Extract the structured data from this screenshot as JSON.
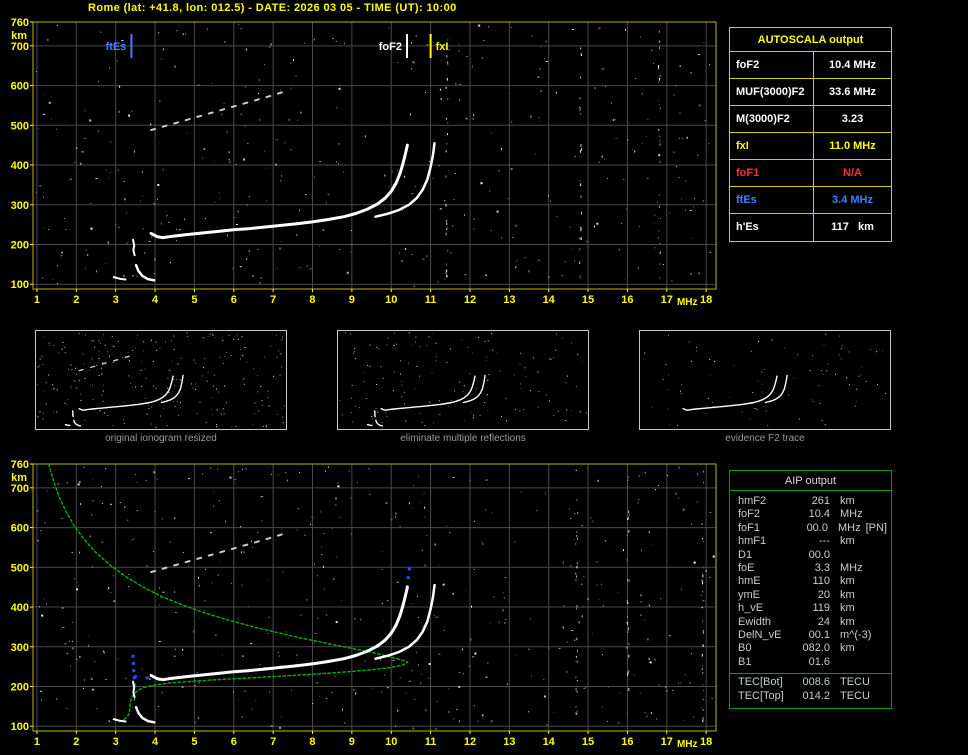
{
  "title": "Rome (lat: +41.8, lon: 012.5) - DATE: 2026 03 05 - TIME (UT): 10:00",
  "colors": {
    "background": "#000000",
    "title": "#ffff00",
    "plot_border": "#b8b800",
    "grid": "#4a4a4a",
    "axis_label": "#ffff00",
    "trace": "#ffffff",
    "profile_green": "#00b400",
    "fit_blue": "#3344ee",
    "ftEs_blue": "#4080ff",
    "fxI_yellow": "#ffff00",
    "na_red": "#ff3333",
    "autoscala_border": "#cfcf00",
    "aip_border": "#00a000"
  },
  "autoscala_table": {
    "title": "AUTOSCALA output",
    "rows": [
      {
        "label": "foF2",
        "value": "10.4 MHz",
        "color": "#ffffff"
      },
      {
        "label": "MUF(3000)F2",
        "value": "33.6 MHz",
        "color": "#ffffff"
      },
      {
        "label": "M(3000)F2",
        "value": "3.23",
        "color": "#ffffff"
      },
      {
        "label": "fxI",
        "value": "11.0 MHz",
        "color": "#ffff00"
      },
      {
        "label": "foF1",
        "value": "N/A",
        "color": "#ff3333"
      },
      {
        "label": "ftEs",
        "value": "3.4 MHz",
        "color": "#4080ff"
      },
      {
        "label": "h'Es",
        "value": "117   km",
        "color": "#ffffff"
      }
    ]
  },
  "aip_table": {
    "title": "AIP output",
    "rows": [
      {
        "label": "hmF2",
        "value": "261",
        "unit": "km",
        "note": ""
      },
      {
        "label": "foF2",
        "value": "10.4",
        "unit": "MHz",
        "note": ""
      },
      {
        "label": "foF1",
        "value": "00.0",
        "unit": "MHz",
        "note": "[PN]"
      },
      {
        "label": "hmF1",
        "value": "---",
        "unit": "km",
        "note": ""
      },
      {
        "label": "D1",
        "value": "00.0",
        "unit": "",
        "note": ""
      },
      {
        "label": "foE",
        "value": "3.3",
        "unit": "MHz",
        "note": ""
      },
      {
        "label": "hmE",
        "value": "110",
        "unit": "km",
        "note": ""
      },
      {
        "label": "ymE",
        "value": "20",
        "unit": "km",
        "note": ""
      },
      {
        "label": "h_vE",
        "value": "119",
        "unit": "km",
        "note": ""
      },
      {
        "label": "Ewidth",
        "value": "24",
        "unit": "km",
        "note": ""
      },
      {
        "label": "DelN_vE",
        "value": "00.1",
        "unit": "m^(-3)",
        "note": ""
      },
      {
        "label": "B0",
        "value": "082.0",
        "unit": "km",
        "note": ""
      },
      {
        "label": "B1",
        "value": "01.6",
        "unit": "",
        "note": ""
      }
    ],
    "tec_rows": [
      {
        "label": "TEC[Bot]",
        "value": "008.6",
        "unit": "TECU",
        "note": ""
      },
      {
        "label": "TEC[Top]",
        "value": "014.2",
        "unit": "TECU",
        "note": ""
      }
    ]
  },
  "thumbnails": [
    {
      "caption": "original ionogram resized"
    },
    {
      "caption": "eliminate multiple reflections"
    },
    {
      "caption": "evidence F2 trace"
    }
  ],
  "chart_data": [
    {
      "id": "ionogram_top",
      "type": "scatter",
      "title": "recorded ionogram with AUTOSCALA characteristics",
      "xlabel": "MHz",
      "ylabel": "km",
      "xlim": [
        1,
        18
      ],
      "ylim": [
        100,
        760
      ],
      "xticks": [
        1,
        2,
        3,
        4,
        5,
        6,
        7,
        8,
        9,
        10,
        11,
        12,
        13,
        14,
        15,
        16,
        17,
        18
      ],
      "yticks": [
        100,
        200,
        300,
        400,
        500,
        600,
        700,
        760
      ],
      "grid": true,
      "markers": [
        {
          "label": "ftEs",
          "freq": 3.4,
          "color": "#4080ff",
          "align": "left"
        },
        {
          "label": "foF2",
          "freq": 10.4,
          "color": "#ffffff",
          "align": "left"
        },
        {
          "label": "fxI",
          "freq": 11.0,
          "color": "#ffff00",
          "align": "right"
        }
      ],
      "rfi_columns": [
        11.4,
        14.8,
        16.8
      ],
      "series": [
        {
          "name": "f2-o-trace",
          "color": "#ffffff",
          "width": 3,
          "points": [
            [
              3.9,
              228
            ],
            [
              4.05,
              220
            ],
            [
              4.2,
              217
            ],
            [
              4.45,
              221
            ],
            [
              4.8,
              225
            ],
            [
              5.2,
              229
            ],
            [
              5.6,
              233
            ],
            [
              6.0,
              237
            ],
            [
              6.4,
              240
            ],
            [
              6.8,
              244
            ],
            [
              7.2,
              248
            ],
            [
              7.6,
              252
            ],
            [
              8.0,
              257
            ],
            [
              8.4,
              263
            ],
            [
              8.8,
              270
            ],
            [
              9.1,
              278
            ],
            [
              9.4,
              289
            ],
            [
              9.65,
              302
            ],
            [
              9.85,
              317
            ],
            [
              10.0,
              334
            ],
            [
              10.12,
              354
            ],
            [
              10.22,
              378
            ],
            [
              10.3,
              404
            ],
            [
              10.36,
              428
            ],
            [
              10.41,
              450
            ]
          ]
        },
        {
          "name": "f2-x-trace",
          "color": "#ffffff",
          "width": 2.5,
          "points": [
            [
              9.6,
              270
            ],
            [
              9.9,
              277
            ],
            [
              10.2,
              287
            ],
            [
              10.45,
              300
            ],
            [
              10.65,
              317
            ],
            [
              10.8,
              338
            ],
            [
              10.92,
              364
            ],
            [
              11.0,
              395
            ],
            [
              11.06,
              425
            ],
            [
              11.1,
              455
            ]
          ]
        },
        {
          "name": "es-hook",
          "color": "#ffffff",
          "width": 2.5,
          "points": [
            [
              3.52,
              148
            ],
            [
              3.58,
              133
            ],
            [
              3.68,
              121
            ],
            [
              3.82,
              113
            ],
            [
              3.98,
              110
            ]
          ]
        },
        {
          "name": "es-low",
          "color": "#ffffff",
          "width": 2,
          "points": [
            [
              2.95,
              118
            ],
            [
              3.1,
              114
            ],
            [
              3.25,
              112
            ]
          ]
        },
        {
          "name": "f-squiggle",
          "color": "#ffffff",
          "width": 2,
          "points": [
            [
              3.44,
              212
            ],
            [
              3.47,
              198
            ],
            [
              3.45,
              186
            ],
            [
              3.48,
              173
            ]
          ]
        },
        {
          "name": "second-reflection",
          "color": "#cccccc",
          "width": 2,
          "dash": "4 8",
          "points": [
            [
              3.9,
              488
            ],
            [
              4.5,
              505
            ],
            [
              5.1,
              522
            ],
            [
              5.7,
              539
            ],
            [
              6.3,
              556
            ],
            [
              6.9,
              573
            ],
            [
              7.4,
              588
            ]
          ]
        }
      ]
    },
    {
      "id": "ionogram_bottom",
      "type": "scatter",
      "title": "ionogram with restored trace and electron density profile (AIP)",
      "xlabel": "MHz",
      "ylabel": "km",
      "xlim": [
        1,
        18
      ],
      "ylim": [
        100,
        760
      ],
      "xticks": [
        1,
        2,
        3,
        4,
        5,
        6,
        7,
        8,
        9,
        10,
        11,
        12,
        13,
        14,
        15,
        16,
        17,
        18
      ],
      "yticks": [
        100,
        200,
        300,
        400,
        500,
        600,
        700,
        760
      ],
      "grid": true,
      "rfi_columns": [
        14.7,
        16.0,
        17.9
      ],
      "series": [
        {
          "name": "ne-profile",
          "color": "#00b400",
          "width": 1.4,
          "dash": "2.5 2.5",
          "points": [
            [
              1.3,
              760
            ],
            [
              1.42,
              718
            ],
            [
              1.56,
              678
            ],
            [
              1.74,
              640
            ],
            [
              1.95,
              604
            ],
            [
              2.2,
              570
            ],
            [
              2.5,
              537
            ],
            [
              2.85,
              506
            ],
            [
              3.25,
              477
            ],
            [
              3.7,
              450
            ],
            [
              4.2,
              425
            ],
            [
              4.75,
              403
            ],
            [
              5.3,
              384
            ],
            [
              5.9,
              366
            ],
            [
              6.5,
              350
            ],
            [
              7.1,
              336
            ],
            [
              7.7,
              322
            ],
            [
              8.3,
              310
            ],
            [
              8.9,
              298
            ],
            [
              9.4,
              288
            ],
            [
              9.8,
              279
            ],
            [
              10.15,
              270
            ],
            [
              10.35,
              264
            ],
            [
              10.42,
              261
            ],
            [
              10.3,
              254
            ],
            [
              10.0,
              248
            ],
            [
              9.5,
              242
            ],
            [
              8.9,
              237
            ],
            [
              8.2,
              232
            ],
            [
              7.5,
              228
            ],
            [
              6.8,
              224
            ],
            [
              6.1,
              220
            ],
            [
              5.4,
              216
            ],
            [
              4.8,
              212
            ],
            [
              4.3,
              208
            ],
            [
              3.95,
              203
            ],
            [
              3.7,
              197
            ],
            [
              3.55,
              189
            ],
            [
              3.45,
              180
            ],
            [
              3.4,
              170
            ],
            [
              3.37,
              158
            ],
            [
              3.36,
              146
            ],
            [
              3.35,
              134
            ],
            [
              3.3,
              124
            ],
            [
              3.2,
              116
            ],
            [
              3.08,
              110
            ]
          ]
        },
        {
          "name": "autoscala-fit",
          "color": "#3344ee",
          "style": "dots",
          "r": 1.7,
          "points": [
            [
              3.5,
              225
            ],
            [
              3.8,
              222
            ],
            [
              4.1,
              218
            ],
            [
              4.4,
              221
            ],
            [
              4.8,
              225
            ],
            [
              5.2,
              229
            ],
            [
              5.6,
              233
            ],
            [
              6.0,
              237
            ],
            [
              6.4,
              241
            ],
            [
              6.8,
              245
            ],
            [
              7.2,
              249
            ],
            [
              7.6,
              253
            ],
            [
              8.0,
              258
            ],
            [
              8.4,
              264
            ],
            [
              8.8,
              271
            ],
            [
              9.1,
              279
            ],
            [
              9.4,
              290
            ],
            [
              9.65,
              303
            ],
            [
              9.85,
              318
            ],
            [
              10.0,
              335
            ],
            [
              10.12,
              355
            ],
            [
              10.22,
              379
            ],
            [
              10.3,
              405
            ],
            [
              10.36,
              429
            ],
            [
              10.4,
              452
            ],
            [
              10.43,
              474
            ],
            [
              10.46,
              496
            ]
          ]
        },
        {
          "name": "fit-extra",
          "color": "#3344ee",
          "style": "dots",
          "r": 1.7,
          "points": [
            [
              3.44,
              276
            ],
            [
              3.45,
              258
            ],
            [
              3.46,
              240
            ],
            [
              3.47,
              222
            ],
            [
              3.48,
              204
            ]
          ]
        },
        {
          "name": "f2-o-trace",
          "color": "#ffffff",
          "width": 3,
          "points": [
            [
              3.9,
              228
            ],
            [
              4.05,
              220
            ],
            [
              4.2,
              217
            ],
            [
              4.45,
              221
            ],
            [
              4.8,
              225
            ],
            [
              5.2,
              229
            ],
            [
              5.6,
              233
            ],
            [
              6.0,
              237
            ],
            [
              6.4,
              240
            ],
            [
              6.8,
              244
            ],
            [
              7.2,
              248
            ],
            [
              7.6,
              252
            ],
            [
              8.0,
              257
            ],
            [
              8.4,
              263
            ],
            [
              8.8,
              270
            ],
            [
              9.1,
              278
            ],
            [
              9.4,
              289
            ],
            [
              9.65,
              302
            ],
            [
              9.85,
              317
            ],
            [
              10.0,
              334
            ],
            [
              10.12,
              354
            ],
            [
              10.22,
              378
            ],
            [
              10.3,
              404
            ],
            [
              10.36,
              428
            ],
            [
              10.41,
              450
            ]
          ]
        },
        {
          "name": "f2-x-trace",
          "color": "#ffffff",
          "width": 2.5,
          "points": [
            [
              9.6,
              270
            ],
            [
              9.9,
              277
            ],
            [
              10.2,
              287
            ],
            [
              10.45,
              300
            ],
            [
              10.65,
              317
            ],
            [
              10.8,
              338
            ],
            [
              10.92,
              364
            ],
            [
              11.0,
              395
            ],
            [
              11.06,
              425
            ],
            [
              11.1,
              455
            ]
          ]
        },
        {
          "name": "es-hook",
          "color": "#ffffff",
          "width": 2.5,
          "points": [
            [
              3.52,
              148
            ],
            [
              3.58,
              133
            ],
            [
              3.68,
              121
            ],
            [
              3.82,
              113
            ],
            [
              3.98,
              110
            ]
          ]
        },
        {
          "name": "es-low",
          "color": "#ffffff",
          "width": 2,
          "points": [
            [
              2.95,
              118
            ],
            [
              3.1,
              114
            ],
            [
              3.25,
              112
            ]
          ]
        },
        {
          "name": "f-squiggle",
          "color": "#ffffff",
          "width": 2,
          "points": [
            [
              3.44,
              212
            ],
            [
              3.47,
              198
            ],
            [
              3.45,
              186
            ],
            [
              3.48,
              173
            ]
          ]
        },
        {
          "name": "second-reflection",
          "color": "#cccccc",
          "width": 2,
          "dash": "4 8",
          "points": [
            [
              3.9,
              488
            ],
            [
              4.5,
              505
            ],
            [
              5.1,
              522
            ],
            [
              5.7,
              539
            ],
            [
              6.3,
              556
            ],
            [
              6.9,
              573
            ],
            [
              7.4,
              588
            ]
          ]
        }
      ]
    }
  ]
}
